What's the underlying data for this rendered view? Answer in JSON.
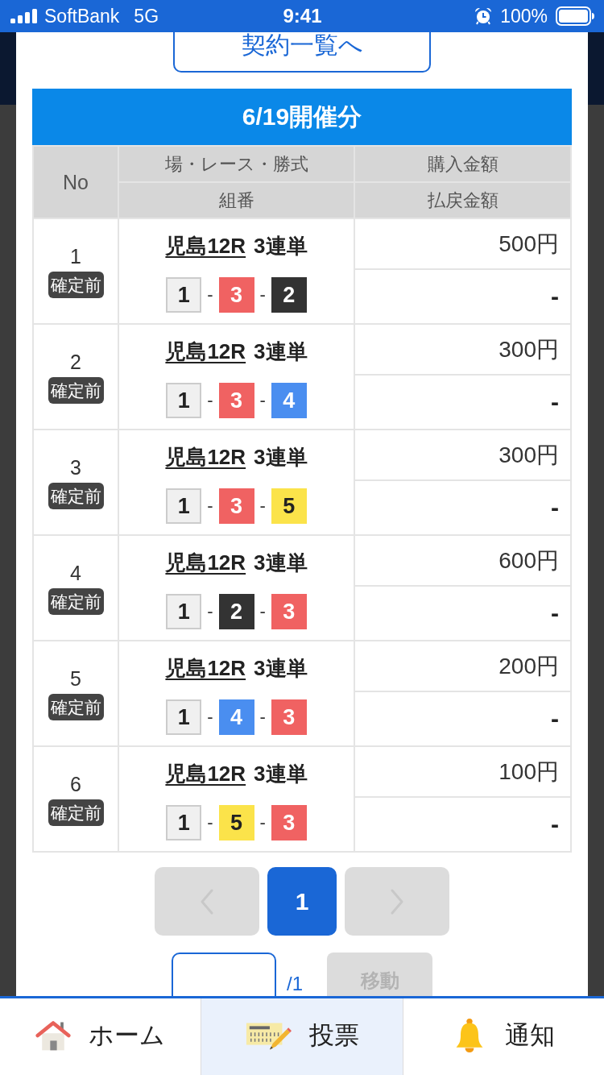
{
  "status_bar": {
    "carrier": "SoftBank",
    "network": "5G",
    "time": "9:41",
    "battery": "100%"
  },
  "contract_list_button": {
    "label": "契約一覧へ"
  },
  "section": {
    "title": "6/19開催分"
  },
  "table": {
    "header": {
      "no": "No",
      "top": [
        "場・レース・勝式",
        "購入金額"
      ],
      "bottom": [
        "組番",
        "払戻金額"
      ]
    },
    "rows": [
      {
        "no": "1",
        "status": "確定前",
        "race": "児島12R",
        "bet_type": "3連単",
        "combination": [
          {
            "kind": "boat",
            "number": "1",
            "color": "#f0f0f0"
          },
          {
            "kind": "separator",
            "text": "-"
          },
          {
            "kind": "boat",
            "number": "3",
            "color": "#f06262"
          },
          {
            "kind": "separator",
            "text": "-"
          },
          {
            "kind": "boat",
            "number": "2",
            "color": "#333333"
          }
        ],
        "purchase_amount": "500円",
        "payout": "-"
      },
      {
        "no": "2",
        "status": "確定前",
        "race": "児島12R",
        "bet_type": "3連単",
        "combination": [
          {
            "kind": "boat",
            "number": "1",
            "color": "#f0f0f0"
          },
          {
            "kind": "separator",
            "text": "-"
          },
          {
            "kind": "boat",
            "number": "3",
            "color": "#f06262"
          },
          {
            "kind": "separator",
            "text": "-"
          },
          {
            "kind": "boat",
            "number": "4",
            "color": "#4a8ef0"
          }
        ],
        "purchase_amount": "300円",
        "payout": "-"
      },
      {
        "no": "3",
        "status": "確定前",
        "race": "児島12R",
        "bet_type": "3連単",
        "combination": [
          {
            "kind": "boat",
            "number": "1",
            "color": "#f0f0f0"
          },
          {
            "kind": "separator",
            "text": "-"
          },
          {
            "kind": "boat",
            "number": "3",
            "color": "#f06262"
          },
          {
            "kind": "separator",
            "text": "-"
          },
          {
            "kind": "boat",
            "number": "5",
            "color": "#fbe34a"
          }
        ],
        "purchase_amount": "300円",
        "payout": "-"
      },
      {
        "no": "4",
        "status": "確定前",
        "race": "児島12R",
        "bet_type": "3連単",
        "combination": [
          {
            "kind": "boat",
            "number": "1",
            "color": "#f0f0f0"
          },
          {
            "kind": "separator",
            "text": "-"
          },
          {
            "kind": "boat",
            "number": "2",
            "color": "#333333"
          },
          {
            "kind": "separator",
            "text": "-"
          },
          {
            "kind": "boat",
            "number": "3",
            "color": "#f06262"
          }
        ],
        "purchase_amount": "600円",
        "payout": "-"
      },
      {
        "no": "5",
        "status": "確定前",
        "race": "児島12R",
        "bet_type": "3連単",
        "combination": [
          {
            "kind": "boat",
            "number": "1",
            "color": "#f0f0f0"
          },
          {
            "kind": "separator",
            "text": "-"
          },
          {
            "kind": "boat",
            "number": "4",
            "color": "#4a8ef0"
          },
          {
            "kind": "separator",
            "text": "-"
          },
          {
            "kind": "boat",
            "number": "3",
            "color": "#f06262"
          }
        ],
        "purchase_amount": "200円",
        "payout": "-"
      },
      {
        "no": "6",
        "status": "確定前",
        "race": "児島12R",
        "bet_type": "3連単",
        "combination": [
          {
            "kind": "boat",
            "number": "1",
            "color": "#f0f0f0"
          },
          {
            "kind": "separator",
            "text": "-"
          },
          {
            "kind": "boat",
            "number": "5",
            "color": "#fbe34a"
          },
          {
            "kind": "separator",
            "text": "-"
          },
          {
            "kind": "boat",
            "number": "3",
            "color": "#f06262"
          }
        ],
        "purchase_amount": "100円",
        "payout": "-"
      }
    ]
  },
  "pagination": {
    "prev": {
      "disabled": true
    },
    "pages": [
      {
        "label": "1",
        "selected": true
      }
    ],
    "next": {
      "disabled": true
    }
  },
  "page_jump": {
    "total": "/1",
    "button": {
      "label": "移動",
      "disabled": true
    }
  },
  "bottom_nav": [
    {
      "label": "ホーム",
      "selected": false
    },
    {
      "label": "投票",
      "selected": true
    },
    {
      "label": "通知",
      "selected": false
    }
  ]
}
